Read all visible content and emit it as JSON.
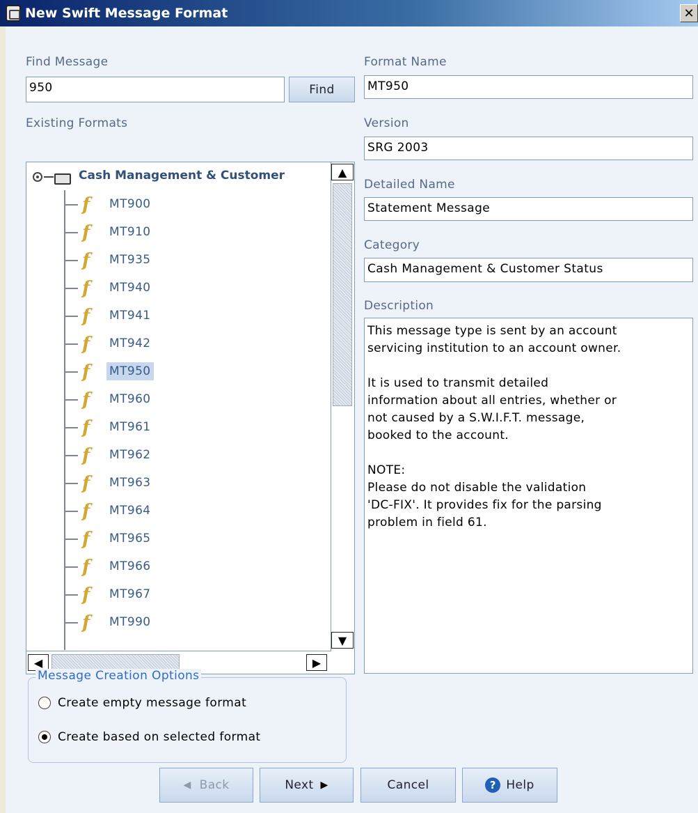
{
  "window": {
    "title": "New Swift Message Format",
    "close_label": "✕"
  },
  "find": {
    "label": "Find Message",
    "value": "950",
    "button": "Find"
  },
  "tree": {
    "label": "Existing Formats",
    "root": "Cash Management & Customer",
    "items": [
      "MT900",
      "MT910",
      "MT935",
      "MT940",
      "MT941",
      "MT942",
      "MT950",
      "MT960",
      "MT961",
      "MT962",
      "MT963",
      "MT964",
      "MT965",
      "MT966",
      "MT967",
      "MT990"
    ],
    "selected": "MT950"
  },
  "fields": {
    "format_name": {
      "label": "Format Name",
      "value": "MT950"
    },
    "version": {
      "label": "Version",
      "value": "SRG 2003"
    },
    "detailed_name": {
      "label": "Detailed Name",
      "value": "Statement Message"
    },
    "category": {
      "label": "Category",
      "value": "Cash Management & Customer Status"
    },
    "description": {
      "label": "Description",
      "value": "This message type is sent by an account\nservicing institution to an account owner.\n\nIt is used to transmit detailed\ninformation about all entries, whether or\nnot caused by a S.W.I.F.T. message,\nbooked to the account.\n\nNOTE:\nPlease do not disable the validation\n'DC-FIX'. It provides fix for the parsing\nproblem in field 61."
    }
  },
  "options": {
    "legend": "Message Creation Options",
    "empty": "Create empty message format",
    "based": "Create based on selected format"
  },
  "buttons": {
    "back": "Back",
    "next": "Next",
    "cancel": "Cancel",
    "help": "Help"
  },
  "colors": {
    "accent": "#2C6AD0",
    "selection": "#C7D8EE",
    "title_bar": "#0A246A"
  }
}
